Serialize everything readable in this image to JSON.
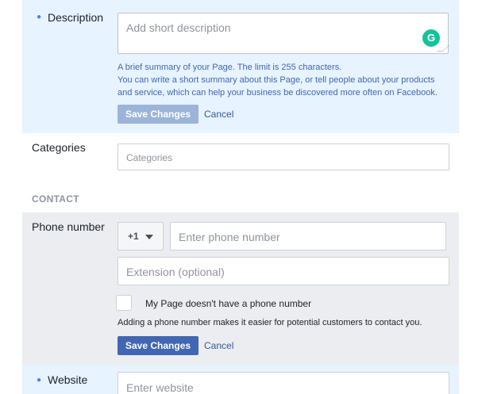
{
  "description": {
    "label": "Description",
    "placeholder": "Add short description",
    "grammarly_badge": "G",
    "help_line1": "A brief summary of your Page. The limit is 255 characters.",
    "help_line2": "You can write a short summary about this Page, or tell people about your products",
    "help_line3": "and service, which can help your business be discovered more often on Facebook.",
    "save_label": "Save Changes",
    "cancel_label": "Cancel"
  },
  "categories": {
    "label": "Categories",
    "placeholder": "Categories"
  },
  "contact": {
    "heading": "CONTACT"
  },
  "phone": {
    "label": "Phone number",
    "country_code": "+1",
    "placeholder": "Enter phone number",
    "extension_placeholder": "Extension (optional)",
    "no_phone_label": "My Page doesn't have a phone number",
    "help": "Adding a phone number makes it easier for potential customers to contact you.",
    "save_label": "Save Changes",
    "cancel_label": "Cancel"
  },
  "website": {
    "label": "Website",
    "placeholder": "Enter website"
  },
  "colors": {
    "highlight_bg": "#e7f3ff",
    "active_bg": "#ebedf0",
    "primary_button": "#4267b2",
    "disabled_button": "#9cb4d8",
    "link": "#385898",
    "help_text": "#4267b2",
    "grammarly": "#15c39a"
  }
}
